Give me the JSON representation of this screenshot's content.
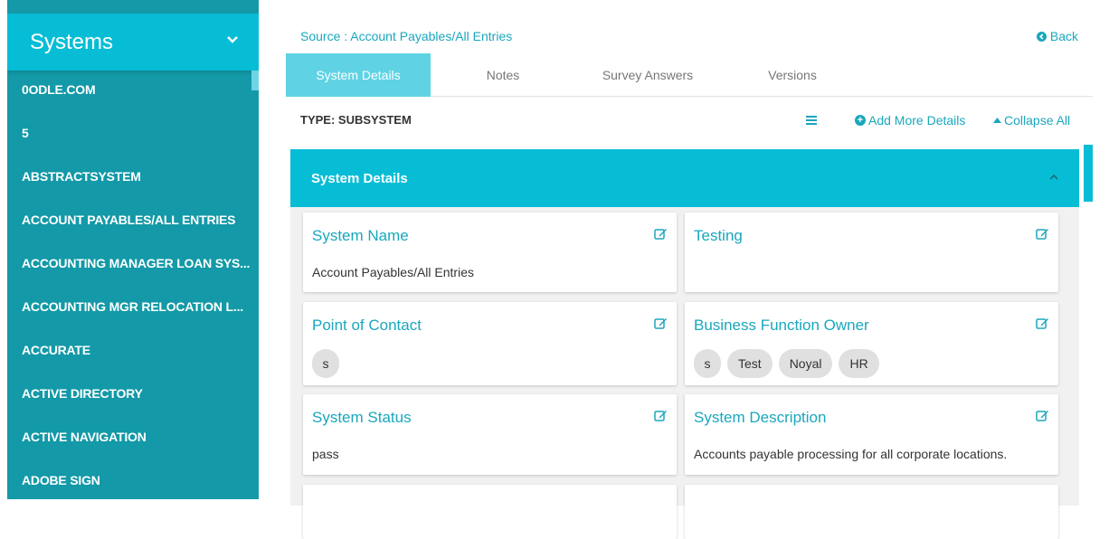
{
  "sidebar": {
    "title": "Systems",
    "items": [
      {
        "label": "0ODLE.COM"
      },
      {
        "label": "5"
      },
      {
        "label": "ABSTRACTSYSTEM"
      },
      {
        "label": "ACCOUNT PAYABLES/ALL ENTRIES"
      },
      {
        "label": "ACCOUNTING MANAGER LOAN SYS..."
      },
      {
        "label": "ACCOUNTING MGR RELOCATION L..."
      },
      {
        "label": "ACCURATE"
      },
      {
        "label": "ACTIVE DIRECTORY"
      },
      {
        "label": "ACTIVE NAVIGATION"
      },
      {
        "label": "ADOBE SIGN"
      }
    ]
  },
  "header": {
    "breadcrumb": "Source : Account Payables/All Entries",
    "back_label": "Back"
  },
  "tabs": [
    {
      "label": "System Details",
      "active": true
    },
    {
      "label": "Notes",
      "active": false
    },
    {
      "label": "Survey Answers",
      "active": false
    },
    {
      "label": "Versions",
      "active": false
    }
  ],
  "toolbar": {
    "type_label": "TYPE: SUBSYSTEM",
    "add_details_label": "Add More Details",
    "collapse_all_label": "Collapse All"
  },
  "section": {
    "title": "System Details",
    "cards": [
      {
        "title": "System Name",
        "value": "Account Payables/All Entries"
      },
      {
        "title": "Testing",
        "value": ""
      },
      {
        "title": "Point of Contact",
        "chips": [
          "s"
        ]
      },
      {
        "title": "Business Function Owner",
        "chips": [
          "s",
          "Test",
          "Noyal",
          "HR"
        ]
      },
      {
        "title": "System Status",
        "value": "pass"
      },
      {
        "title": "System Description",
        "value": "Accounts payable processing for all corporate locations."
      }
    ]
  },
  "colors": {
    "accent": "#07bdd6",
    "sidebar_bg": "#1399a7",
    "link": "#1aa7bd",
    "active_tab": "#5fd3e4"
  },
  "icons": {
    "sidebar_toggle": "chevron-down-icon",
    "back": "chevron-left-circle-icon",
    "menu": "hamburger-icon",
    "add": "plus-circle-icon",
    "collapse": "caret-up-icon",
    "section_toggle": "chevron-up-icon",
    "edit": "edit-icon"
  }
}
